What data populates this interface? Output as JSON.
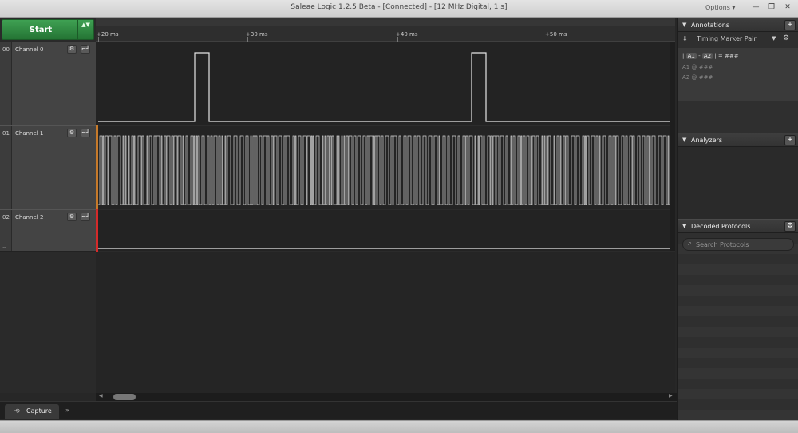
{
  "window": {
    "title": "Saleae Logic 1.2.5 Beta - [Connected] - [12 MHz Digital, 1 s]",
    "options_label": "Options ▾",
    "minimize": "—",
    "restore": "❐",
    "close": "✕"
  },
  "capture": {
    "start_label": "Start",
    "arrows": "▲▼",
    "tab_label": "Capture",
    "tab_icon": "⟲",
    "tab_more": "»"
  },
  "channels": [
    {
      "num": "00",
      "name": "Channel 0",
      "gear": "⚙",
      "trigger": "⌐┘"
    },
    {
      "num": "01",
      "name": "Channel 1",
      "gear": "⚙",
      "trigger": "⌐┘"
    },
    {
      "num": "02",
      "name": "Channel 2",
      "gear": "⚙",
      "trigger": "⌐┘"
    }
  ],
  "ruler": {
    "ticks": [
      "+20 ms",
      "+30 ms",
      "+40 ms",
      "+50 ms"
    ]
  },
  "annotations": {
    "title": "Annotations",
    "add_btn": "+",
    "marker_label": "Timing Marker Pair",
    "marker_pin": "⬇",
    "marker_dropdown": "▼",
    "marker_gear": "⚙",
    "a1": "A1",
    "a2": "A2",
    "dash": "-",
    "bar": "|",
    "eq": "= ###",
    "at": "@",
    "hash": "###"
  },
  "analyzers": {
    "title": "Analyzers",
    "add_btn": "+"
  },
  "decoded": {
    "title": "Decoded Protocols",
    "gear_btn": "⚙",
    "search_placeholder": "Search Protocols",
    "search_icon": "⌕"
  },
  "section_triangle": "▼",
  "grip": "....."
}
